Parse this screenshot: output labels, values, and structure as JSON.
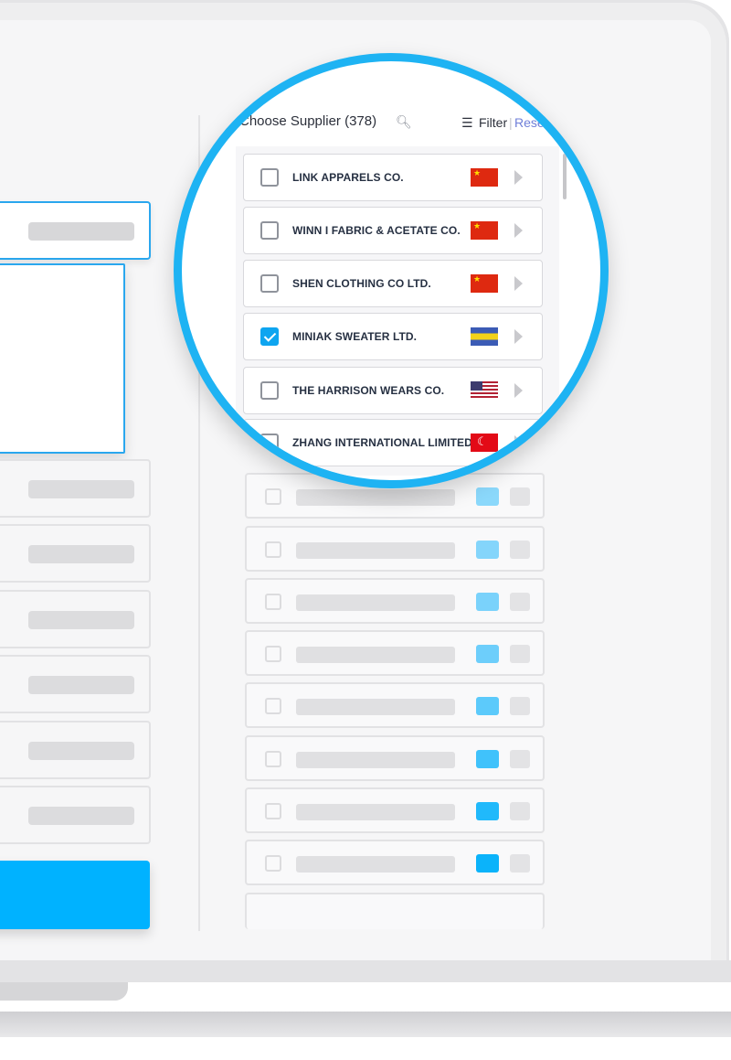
{
  "supplier_panel": {
    "title": "Choose Supplier (378)",
    "search_icon": "search-icon",
    "filter_label": "Filter",
    "separator": "|",
    "reset_label": "Reset",
    "suppliers": [
      {
        "name": "LINK APPARELS CO.",
        "flag": "china-flag-icon",
        "checked": false
      },
      {
        "name": "WINN I FABRIC & ACETATE CO.",
        "flag": "china-flag-icon",
        "checked": false
      },
      {
        "name": "SHEN CLOTHING CO LTD.",
        "flag": "china-flag-icon",
        "checked": false
      },
      {
        "name": "MINIAK SWEATER LTD.",
        "flag": "blue-yellow-flag-icon",
        "checked": true
      },
      {
        "name": "THE HARRISON WEARS CO.",
        "flag": "usa-flag-icon",
        "checked": false
      },
      {
        "name": "ZHANG INTERNATIONAL LIMITED",
        "flag": "turkey-flag-icon",
        "checked": false
      }
    ]
  },
  "colors": {
    "accent": "#1eb3f3",
    "primary_button": "#00b2ff",
    "checkbox_checked": "#0ea5f0",
    "reset_link": "#6f7fd8"
  },
  "icons": {
    "star": "★",
    "crescent": "☾",
    "filter": "☰"
  }
}
